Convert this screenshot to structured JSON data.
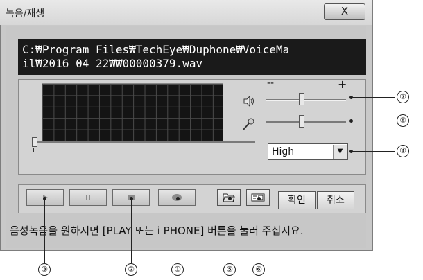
{
  "window": {
    "title": "녹음/재생",
    "close_label": "X"
  },
  "file_path": {
    "line1": "C:₩Program Files₩TechEye₩Duphone₩VoiceMa",
    "line2": "il₩2016 04 22₩₩00000379.wav"
  },
  "levels": {
    "minus_label": "--",
    "plus_label": "+",
    "speaker_level": 0.45,
    "mic_level": 0.45,
    "position": 0.0
  },
  "quality": {
    "value": "High"
  },
  "buttons": {
    "confirm_label": "확인",
    "cancel_label": "취소"
  },
  "status": {
    "message": "음성녹음을 원하시면 [PLAY 또는 i PHONE] 버튼을 눌러 주십시요."
  },
  "callouts": {
    "n1": "①",
    "n2": "②",
    "n3": "③",
    "n4": "④",
    "n5": "⑤",
    "n6": "⑥",
    "n7": "⑦",
    "n8": "⑧"
  },
  "icons": {
    "play": "play-icon",
    "pause": "pause-icon",
    "stop": "stop-icon",
    "record": "record-icon",
    "open": "folder-open-icon",
    "save": "save-icon",
    "speaker": "speaker-icon",
    "mic": "microphone-icon"
  }
}
